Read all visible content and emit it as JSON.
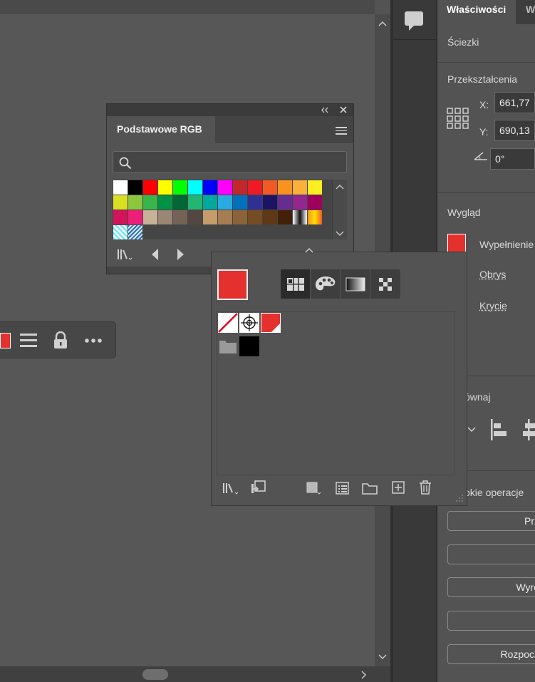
{
  "right_panel": {
    "tabs": [
      "Właściwości",
      "W"
    ],
    "sciezki": "Ściezki",
    "transform_title": "Przekształcenia",
    "x_label": "X:",
    "x_value": "661,77",
    "y_label": "Y:",
    "y_value": "690,13",
    "angle_value": "0°",
    "appearance_title": "Wygląd",
    "fill_label": "Wypełnienie",
    "stroke_label": "Obrys",
    "opacity_label": "Krycie",
    "align_title": "ównaj",
    "quick_title": "okie operacje",
    "buttons": [
      "Prz",
      "",
      "Wyró",
      "",
      "Rozpocz"
    ]
  },
  "swatch_panel": {
    "title": "Podstawowe RGB",
    "search_placeholder": "",
    "colors": [
      "#ffffff",
      "#000000",
      "#ff0000",
      "#ffff00",
      "#00ff00",
      "#00ffff",
      "#0000ff",
      "#ff00ff",
      "#c1272d",
      "#ed1c24",
      "#f15a24",
      "#f7931e",
      "#fbb03b",
      "#fcee21",
      "#d9e021",
      "#8cc63f",
      "#39b54a",
      "#009245",
      "#006837",
      "#22b573",
      "#00a99d",
      "#29abe2",
      "#0071bc",
      "#2e3192",
      "#1b1464",
      "#662d91",
      "#93278f",
      "#9e005d",
      "#d4145a",
      "#ed1e79",
      "#c7b299",
      "#998675",
      "#736357",
      "#534741",
      "#c69c6d",
      "#a67c52",
      "#8c6239",
      "#754c24",
      "#603813",
      "#42210b",
      "gradient-gray",
      "gradient-orange",
      "pattern-cyan",
      "pattern-blue"
    ]
  },
  "color_panel": {
    "current_color": "#e5312e",
    "swatches": [
      "none",
      "registration",
      "#e5312e",
      "folder",
      "#000000"
    ]
  },
  "icons": {
    "comment": "comment-icon",
    "lock": "lock-icon",
    "more": "more-icon",
    "menu": "menu-icon"
  }
}
